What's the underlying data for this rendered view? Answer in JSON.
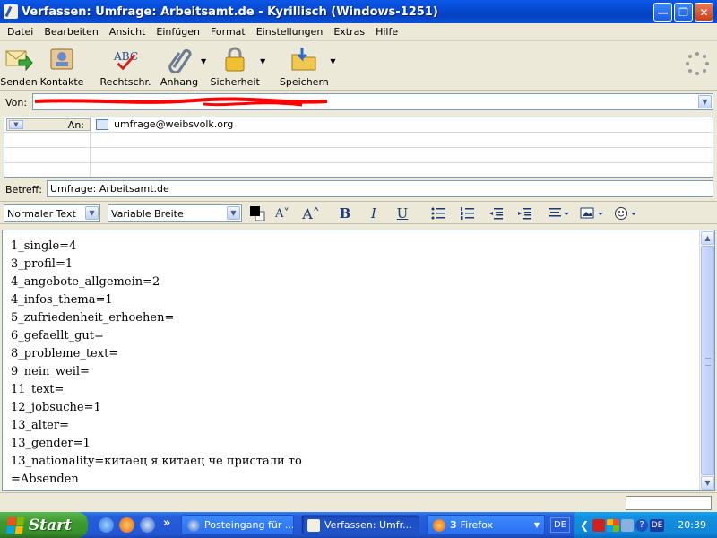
{
  "window": {
    "title": "Verfassen: Umfrage: Arbeitsamt.de - Kyrillisch (Windows-1251)"
  },
  "menu": [
    "Datei",
    "Bearbeiten",
    "Ansicht",
    "Einfügen",
    "Format",
    "Einstellungen",
    "Extras",
    "Hilfe"
  ],
  "toolbar": {
    "send": "Senden",
    "contacts": "Kontakte",
    "spell": "Rechtschr.",
    "attach": "Anhang",
    "security": "Sicherheit",
    "save": "Speichern"
  },
  "header": {
    "from_label": "Von:",
    "from_value": "",
    "to_type": "An:",
    "to_value": "umfrage@weibsvolk.org",
    "subject_label": "Betreff:",
    "subject_value": "Umfrage: Arbeitsamt.de"
  },
  "format": {
    "paragraph_style": "Normaler Text",
    "font": "Variable Breite",
    "bold": "B",
    "italic": "I",
    "underline": "U"
  },
  "body_lines": [
    "1_single=4",
    "3_profil=1",
    "4_angebote_allgemein=2",
    "4_infos_thema=1",
    "5_zufriedenheit_erhoehen=",
    "6_gefaellt_gut=",
    "8_probleme_text=",
    "9_nein_weil=",
    "11_text=",
    "12_jobsuche=1",
    "13_alter=",
    "13_gender=1",
    "13_nationality=китаец я китаец че пристали то",
    "=Absenden"
  ],
  "taskbar": {
    "start": "Start",
    "quicklaunch_more": "»",
    "tasks": [
      {
        "label": "Posteingang für ..."
      },
      {
        "label": "Verfassen: Umfr..."
      },
      {
        "count": "3",
        "label": "Firefox"
      }
    ],
    "lang": "DE",
    "tray_lang": "DE",
    "clock": "20:39"
  },
  "colors": {
    "titlebar": "#0a58e8",
    "redaction": "#ff0000"
  }
}
